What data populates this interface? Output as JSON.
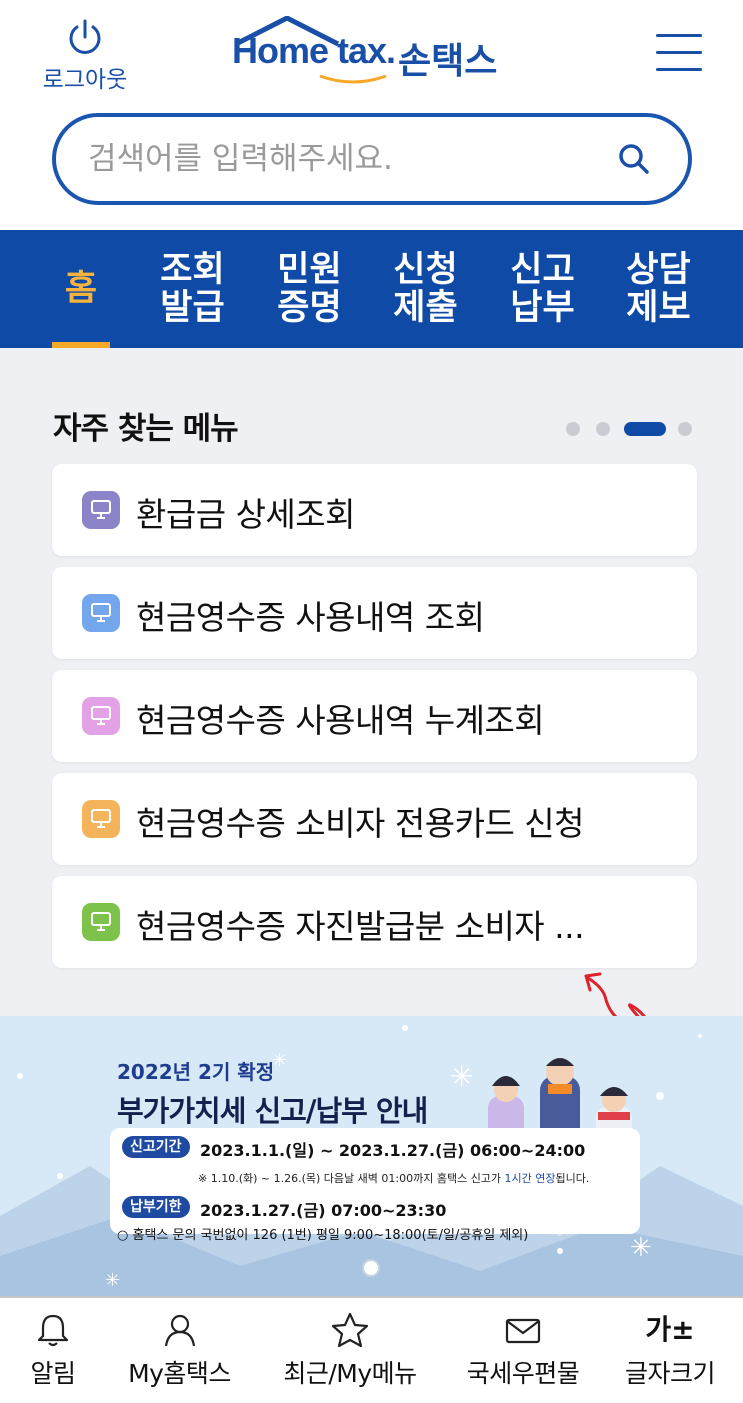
{
  "header": {
    "logout_label": "로그아웃",
    "logo_text": "Home tax.",
    "logo_korean": "손택스"
  },
  "search": {
    "placeholder": "검색어를 입력해주세요."
  },
  "nav": {
    "items": [
      {
        "line1": "홈",
        "line2": ""
      },
      {
        "line1": "조회",
        "line2": "발급"
      },
      {
        "line1": "민원",
        "line2": "증명"
      },
      {
        "line1": "신청",
        "line2": "제출"
      },
      {
        "line1": "신고",
        "line2": "납부"
      },
      {
        "line1": "상담",
        "line2": "제보"
      }
    ],
    "active_index": 0,
    "active_color": "#f6b33e"
  },
  "frequent": {
    "title": "자주 찾는 메뉴",
    "pager": {
      "total": 4,
      "active": 2
    },
    "items": [
      {
        "label": "환급금 상세조회",
        "color": "#8c84c9"
      },
      {
        "label": "현금영수증 사용내역 조회",
        "color": "#74a6ee"
      },
      {
        "label": "현금영수증 사용내역 누계조회",
        "color": "#e3a1e6"
      },
      {
        "label": "현금영수증 소비자 전용카드 신청",
        "color": "#f3b45c"
      },
      {
        "label": "현금영수증 자진발급분 소비자 ...",
        "color": "#7dc24b"
      }
    ]
  },
  "banner": {
    "subtitle": "2022년 2기 확정",
    "title": "부가가치세 신고/납부 안내",
    "filing_label": "신고기간",
    "filing_period": "2023.1.1.(일) ~ 2023.1.27.(금) 06:00~24:00",
    "note_prefix": "※ 1.10.(화) ~ 1.26.(목) 다음날 새벽 01:00까지 홈택스 신고가 ",
    "note_highlight": "1시간 연장",
    "note_suffix": "됩니다.",
    "payment_label": "납부기한",
    "payment_period": "2023.1.27.(금) 07:00~23:30",
    "contact": "홈택스 문의 국번없이 126 (1번) 평일 9:00~18:00(토/일/공휴일 제외)"
  },
  "bottom_nav": {
    "items": [
      {
        "label": "알림",
        "icon": "bell-icon"
      },
      {
        "label": "My홈택스",
        "icon": "person-icon"
      },
      {
        "label": "최근/My메뉴",
        "icon": "star-icon"
      },
      {
        "label": "국세우편물",
        "icon": "mail-icon"
      },
      {
        "label": "글자크기",
        "icon": "font-size-icon"
      }
    ],
    "font_size_glyph": "가±"
  }
}
